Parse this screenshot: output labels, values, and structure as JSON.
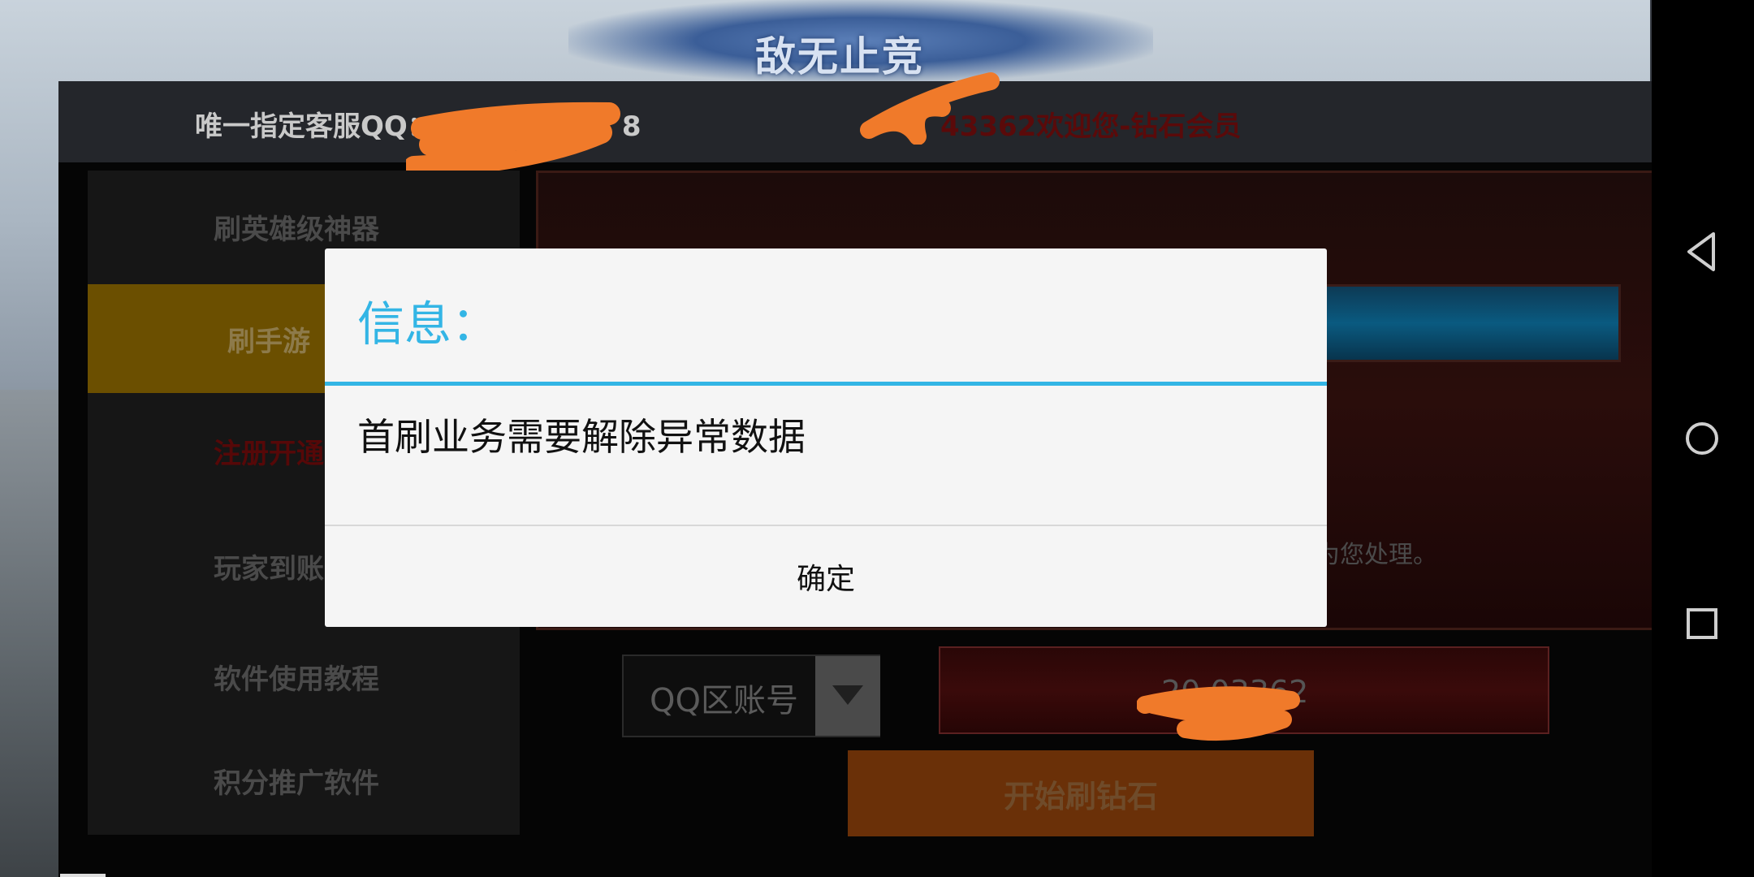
{
  "background": {
    "banner_text": "敌无止竞"
  },
  "header": {
    "support_label": "唯一指定客服QQ：",
    "support_suffix": "8",
    "welcome_partial": "43362欢迎您-钻石会员"
  },
  "sidebar": {
    "items": [
      {
        "label": "刷英雄级神器"
      },
      {
        "label": "刷手游"
      },
      {
        "label": "注册开通"
      },
      {
        "label": "玩家到账"
      },
      {
        "label": "软件使用教程"
      },
      {
        "label": "积分推广软件"
      }
    ]
  },
  "content": {
    "notice_tail": "为您处理。",
    "account_type": "QQ区账号",
    "account_number_partial": "20  03362",
    "start_button": "开始刷钻石"
  },
  "dialog": {
    "title": "信息：",
    "message": "首刷业务需要解除异常数据",
    "ok_button": "确定"
  },
  "colors": {
    "dialog_accent": "#33b5e5",
    "active_item": "#6b4f00",
    "scribble": "#f07a2a"
  },
  "icons": {
    "nav_back": "back-triangle-icon",
    "nav_home": "home-circle-icon",
    "nav_recent": "recent-square-icon"
  }
}
